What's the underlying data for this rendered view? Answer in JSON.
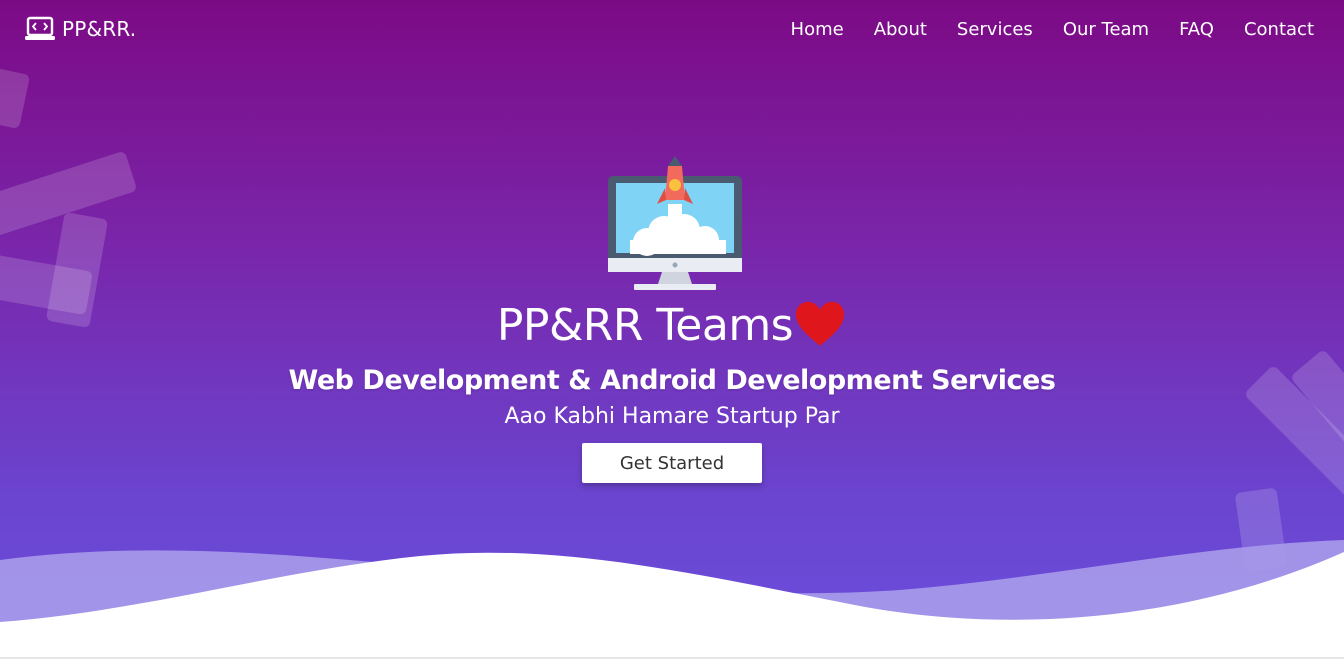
{
  "navbar": {
    "brand": "PP&RR.",
    "brand_icon": "laptop-code-icon",
    "links": [
      "Home",
      "About",
      "Services",
      "Our Team",
      "FAQ",
      "Contact"
    ]
  },
  "hero": {
    "illustration": "monitor-rocket-icon",
    "title": "PP&RR Teams",
    "title_icon": "heart-icon",
    "subtitle": "Web Development & Android Development Services",
    "tagline": "Aao Kabhi Hamare Startup Par",
    "cta_label": "Get Started"
  },
  "colors": {
    "gradient_top": "#7c0a85",
    "gradient_bottom": "#6a4fdc",
    "heart": "#e0161d",
    "wave": "#ffffff"
  }
}
